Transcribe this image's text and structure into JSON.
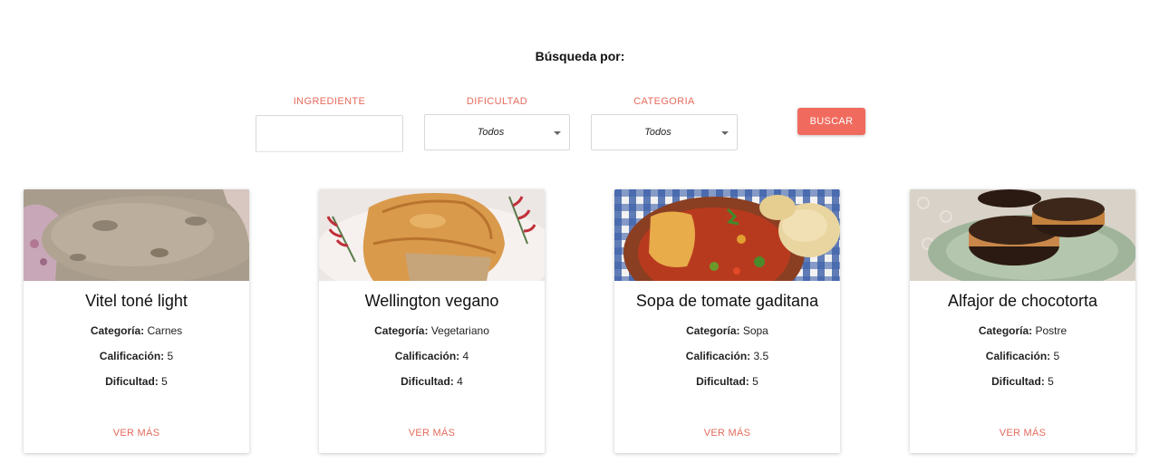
{
  "search": {
    "title": "Búsqueda por:",
    "ingrediente_label": "INGREDIENTE",
    "ingrediente_value": "",
    "dificultad_label": "DIFICULTAD",
    "dificultad_value": "Todos",
    "categoria_label": "CATEGORIA",
    "categoria_value": "Todos",
    "button_label": "BUSCAR"
  },
  "labels": {
    "categoria": "Categoría:",
    "calificacion": "Calificación:",
    "dificultad": "Dificultad:"
  },
  "recipes": [
    {
      "title": "Vitel toné light",
      "categoria": "Carnes",
      "calificacion": "5",
      "dificultad": "5",
      "link": "VER MÁS",
      "image": "vitel-tone-photo"
    },
    {
      "title": "Wellington vegano",
      "categoria": "Vegetariano",
      "calificacion": "4",
      "dificultad": "4",
      "link": "VER MÁS",
      "image": "wellington-photo"
    },
    {
      "title": "Sopa de tomate gaditana",
      "categoria": "Sopa",
      "calificacion": "3.5",
      "dificultad": "5",
      "link": "VER MÁS",
      "image": "sopa-tomate-photo"
    },
    {
      "title": "Alfajor de chocotorta",
      "categoria": "Postre",
      "calificacion": "5",
      "dificultad": "5",
      "link": "VER MÁS",
      "image": "alfajor-photo"
    }
  ],
  "colors": {
    "accent": "#f06b5e",
    "label": "#e56b5d"
  }
}
